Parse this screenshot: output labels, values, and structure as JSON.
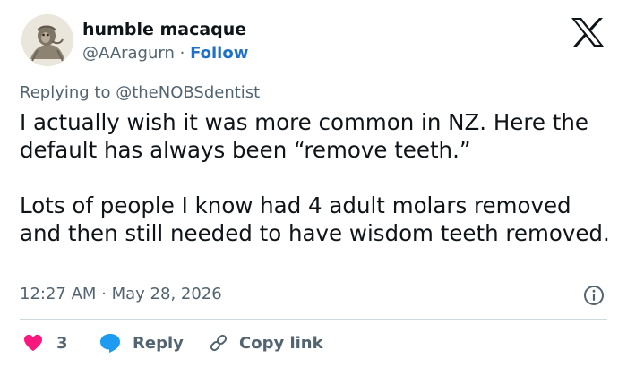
{
  "author": {
    "display_name": "humble macaque",
    "handle": "@AAragurn",
    "separator": "·",
    "follow_label": "Follow"
  },
  "reply_context": {
    "prefix": "Replying to ",
    "mention": "@theNOBSdentist"
  },
  "tweet": {
    "paragraph_1": "I actually wish it was more common in NZ. Here the default has always been “remove teeth.”",
    "paragraph_2": "Lots of people I know had 4 adult molars removed and then still needed to have wisdom teeth removed."
  },
  "meta": {
    "timestamp": "12:27 AM · May 28, 2026"
  },
  "actions": {
    "like_count": "3",
    "reply_label": "Reply",
    "copy_link_label": "Copy link"
  },
  "icons": {
    "brand": "x-logo-icon",
    "info": "info-icon",
    "like": "heart-icon",
    "reply": "speech-bubble-icon",
    "copy": "link-icon"
  },
  "colors": {
    "text_primary": "#0f1419",
    "text_secondary": "#536471",
    "link_blue": "#1d72c8",
    "like_red": "#f91880",
    "reply_blue": "#1d9bf0",
    "divider": "#cfd9de"
  }
}
